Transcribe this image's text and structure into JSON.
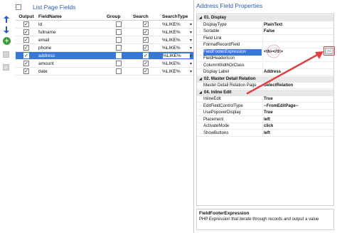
{
  "left_panel": {
    "title": "List Page Fields",
    "columns": [
      "Output",
      "FieldName",
      "Group",
      "Search",
      "SearchType"
    ],
    "rows": [
      {
        "output": true,
        "name": "id",
        "group": false,
        "search": true,
        "search_type": "%LIKE%",
        "selected": false
      },
      {
        "output": true,
        "name": "fullname",
        "group": false,
        "search": true,
        "search_type": "%LIKE%",
        "selected": false
      },
      {
        "output": true,
        "name": "email",
        "group": false,
        "search": true,
        "search_type": "%LIKE%",
        "selected": false
      },
      {
        "output": true,
        "name": "phone",
        "group": false,
        "search": true,
        "search_type": "%LIKE%",
        "selected": false
      },
      {
        "output": true,
        "name": "address",
        "group": false,
        "search": true,
        "search_type": "%LIKE%",
        "selected": true
      },
      {
        "output": true,
        "name": "amount",
        "group": false,
        "search": true,
        "search_type": "%LIKE%",
        "selected": false
      },
      {
        "output": true,
        "name": "date",
        "group": false,
        "search": true,
        "search_type": "%LIKE%",
        "selected": false
      }
    ]
  },
  "toolbar": {
    "icons": [
      "arrow-up-icon",
      "arrow-down-icon",
      "add-icon",
      "disabled-icon",
      "disabled-check-icon"
    ],
    "add_label": "+",
    "check_label": "✓"
  },
  "right_panel": {
    "title": "Address Field Properties",
    "sections": [
      {
        "label": "01. Display",
        "rows": [
          {
            "key": "DisplayType",
            "value": "PlainText"
          },
          {
            "key": "Sortable",
            "value": "False"
          },
          {
            "key": "Field Link",
            "value": ""
          },
          {
            "key": "FormatRecordField",
            "value": ""
          },
          {
            "key": "FieldFooterExpression",
            "value": "<th></th>"
          },
          {
            "key": "FieldHeaderIcon",
            "value": ""
          },
          {
            "key": "ColumnWidthOrClass",
            "value": ""
          },
          {
            "key": "Display Label",
            "value": "Address"
          }
        ]
      },
      {
        "label": "02. Master Detail Relation",
        "rows": [
          {
            "key": "Master Detail Relation Page",
            "value": "SelectRelation"
          }
        ]
      },
      {
        "label": "04. Inline Edit",
        "rows": [
          {
            "key": "InlineEdit",
            "value": "True"
          },
          {
            "key": "EditFieldControlType",
            "value": "--FromEditPage--"
          },
          {
            "key": "UsePopoverDisplay",
            "value": "True"
          },
          {
            "key": "Placement",
            "value": "left"
          },
          {
            "key": "ActivateMode",
            "value": "click"
          },
          {
            "key": "ShowButtons",
            "value": "left"
          }
        ]
      }
    ],
    "ellipsis_label": "...",
    "description": {
      "title": "FieldFooterExpression",
      "text": "PHP Expression that iterate through records and output a value"
    }
  },
  "colors": {
    "selection": "#3a78d8",
    "title": "#2d5fa8",
    "annotation": "#e04040"
  }
}
